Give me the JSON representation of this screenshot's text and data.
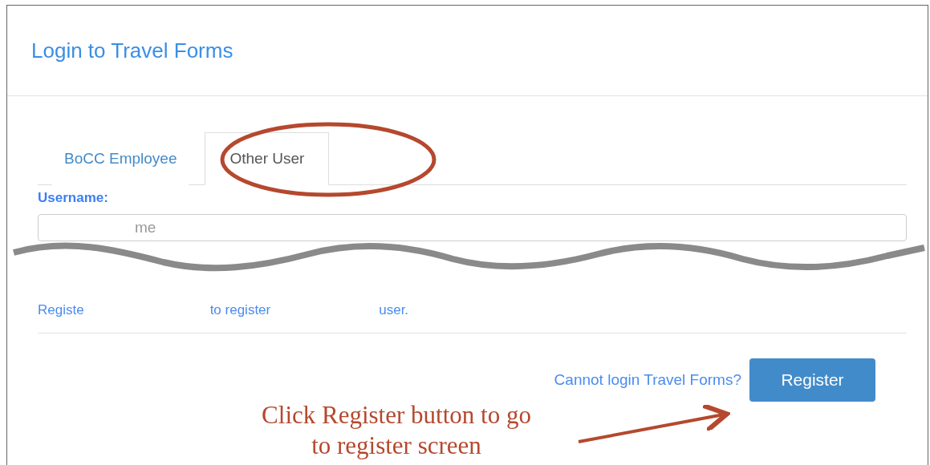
{
  "dialog": {
    "title": "Login to Travel Forms"
  },
  "tabs": [
    {
      "label": "BoCC Employee",
      "selected": false
    },
    {
      "label": "Other User",
      "selected": true
    }
  ],
  "username": {
    "label": "Username:",
    "placeholder": "me"
  },
  "notice_fragments": [
    "Registe",
    "to register",
    "user."
  ],
  "footer": {
    "help_link": "Cannot login Travel Forms?",
    "button": "Register"
  },
  "annotation": {
    "text": "Click Register button to go to register screen"
  }
}
